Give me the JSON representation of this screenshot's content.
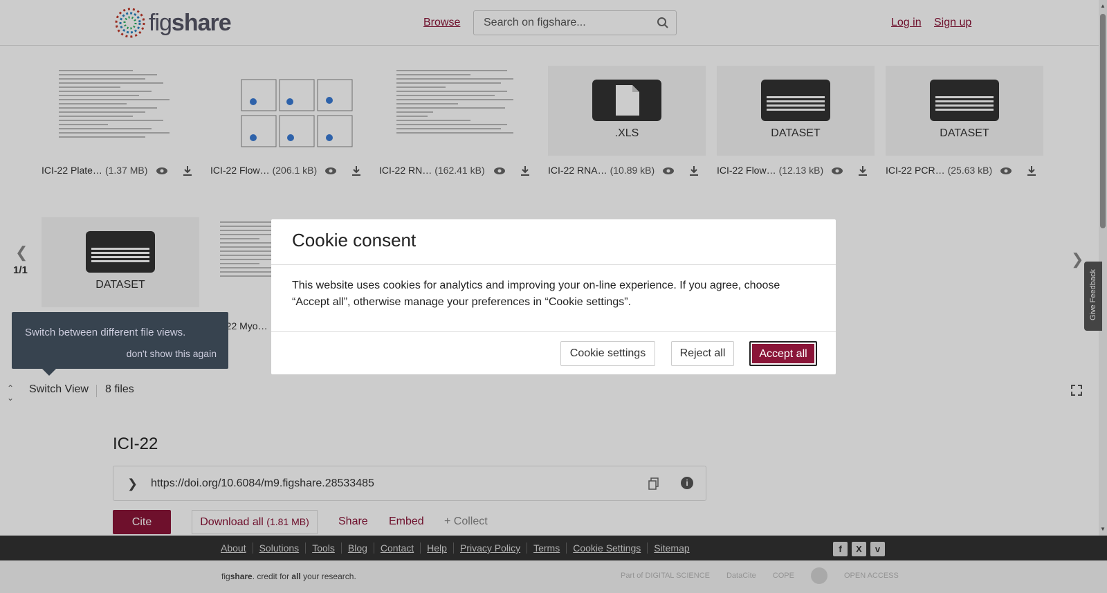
{
  "header": {
    "logo_text_a": "fig",
    "logo_text_b": "share",
    "browse": "Browse",
    "search_placeholder": "Search on figshare...",
    "login": "Log in",
    "signup": "Sign up"
  },
  "viewer": {
    "page_indicator": "1/1",
    "files": [
      {
        "name": "ICI-22 Plate…",
        "size": "(1.37 MB)"
      },
      {
        "name": "ICI-22 Flow…",
        "size": "(206.1 kB)"
      },
      {
        "name": "ICI-22 RN…",
        "size": "(162.41 kB)"
      },
      {
        "name": "ICI-22 RNA…",
        "size": "(10.89 kB)",
        "type_label": ".XLS"
      },
      {
        "name": "ICI-22 Flow…",
        "size": "(12.13 kB)",
        "type_label": "DATASET"
      },
      {
        "name": "ICI-22 PCR…",
        "size": "(25.63 kB)",
        "type_label": "DATASET"
      },
      {
        "type_label": "DATASET"
      },
      {
        "name": "-22 Myo…"
      }
    ],
    "tooltip": {
      "text": "Switch between different file views.",
      "dismiss": "don't show this again"
    },
    "switch_view": "Switch View",
    "file_count": "8 files"
  },
  "article": {
    "title": "ICI-22",
    "doi_url": "https://doi.org/10.6084/m9.figshare.28533485",
    "cite": "Cite",
    "download_all": "Download all",
    "download_size": "(1.81 MB)",
    "share": "Share",
    "embed": "Embed",
    "collect": "+ Collect"
  },
  "cookie": {
    "title": "Cookie consent",
    "body": "This website uses cookies for analytics and improving your on-line experience. If you agree, choose “Accept all”, otherwise manage your preferences in “Cookie settings”.",
    "settings": "Cookie settings",
    "reject": "Reject all",
    "accept": "Accept all"
  },
  "footer": {
    "links": [
      "About",
      "Solutions",
      "Tools",
      "Blog",
      "Contact",
      "Help",
      "Privacy Policy",
      "Terms",
      "Cookie Settings",
      "Sitemap"
    ],
    "tag_fig": "fig",
    "tag_share": "share",
    "tag_mid": ". credit for ",
    "tag_all": "all",
    "tag_end": " your research.",
    "partners": [
      "Part of DIGITAL SCIENCE",
      "DataCite",
      "COPE",
      "",
      "OPEN ACCESS"
    ]
  },
  "feedback": "Give Feedback",
  "colors": {
    "brand": "#8a1538",
    "footer_bg": "#333333"
  }
}
